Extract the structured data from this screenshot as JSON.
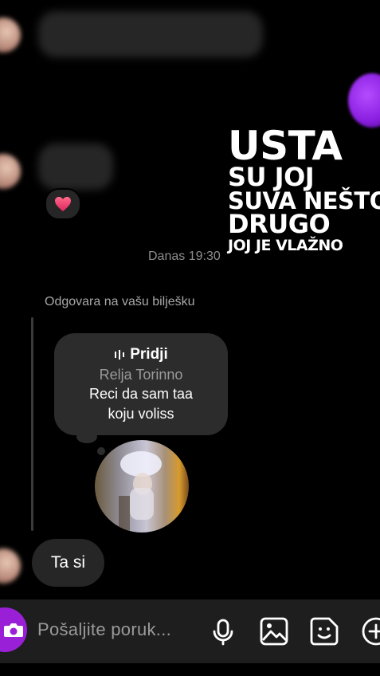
{
  "thread": {
    "timestamp": "Danas 19:30",
    "reply_context": "Odgovara na vašu bilješku",
    "note": {
      "song_title": "Pridji",
      "artist": "Relja Torinno",
      "text_line1": "Reci da sam taa",
      "text_line2": "koju voliss"
    },
    "reaction": "❤️",
    "reply_message": "Ta si"
  },
  "overlay": {
    "line1": "USTA",
    "line2": "SU JOJ",
    "line3": "SUVA NEŠTO",
    "line4": "DRUGO",
    "line5": "JOJ JE VLAŽNO"
  },
  "composer": {
    "placeholder": "Pošaljite poruk..."
  },
  "icons": {
    "camera": "camera-icon",
    "microphone": "microphone-icon",
    "gallery": "gallery-icon",
    "sticker": "sticker-icon",
    "add": "add-icon",
    "music": "music-icon",
    "heart": "heart-icon"
  },
  "colors": {
    "accent": "#9a20d8",
    "bubble": "#262626",
    "background": "#000000"
  }
}
